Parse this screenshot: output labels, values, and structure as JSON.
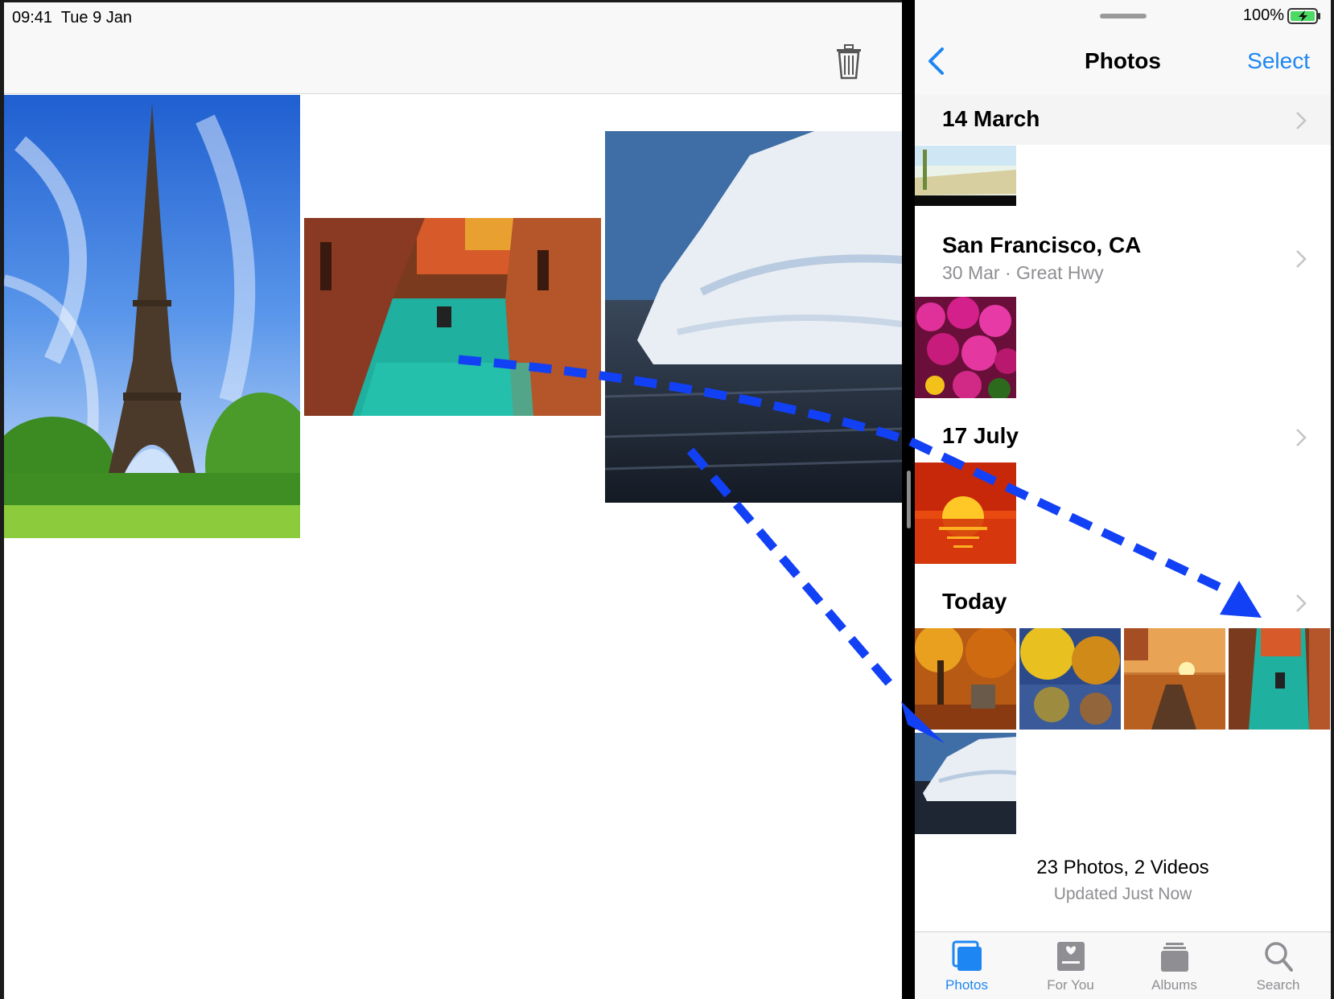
{
  "status": {
    "time": "09:41  Tue 9 Jan",
    "battery": "100%"
  },
  "left_app": {
    "toolbar": {
      "trash_icon": "trash-icon"
    },
    "photos": [
      {
        "name": "eiffel-tower-photo",
        "subject": "Eiffel Tower"
      },
      {
        "name": "venice-canal-photo",
        "subject": "Venice canal"
      },
      {
        "name": "iceberg-photo",
        "subject": "Iceberg"
      }
    ]
  },
  "right_app": {
    "nav": {
      "back_icon": "chevron-left-icon",
      "title": "Photos",
      "select_label": "Select"
    },
    "sections": [
      {
        "title": "14 March",
        "subtitle": ""
      },
      {
        "title": "San Francisco, CA",
        "subtitle": "30 Mar  ·  Great Hwy"
      },
      {
        "title": "17 July",
        "subtitle": ""
      },
      {
        "title": "Today",
        "subtitle": ""
      }
    ],
    "footer": {
      "count": "23 Photos, 2 Videos",
      "updated": "Updated Just Now"
    },
    "tabs": [
      {
        "label": "Photos",
        "icon": "photos-icon",
        "active": true
      },
      {
        "label": "For You",
        "icon": "for-you-icon",
        "active": false
      },
      {
        "label": "Albums",
        "icon": "albums-icon",
        "active": false
      },
      {
        "label": "Search",
        "icon": "search-icon",
        "active": false
      }
    ]
  },
  "colors": {
    "accent": "#1e86f2",
    "arrow": "#1240f5",
    "battery": "#4cd964",
    "secondary_text": "#8e8e93"
  }
}
